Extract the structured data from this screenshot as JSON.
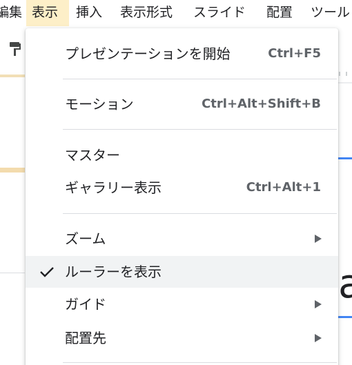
{
  "menubar": {
    "items": [
      {
        "label": "編集",
        "active": false
      },
      {
        "label": "表示",
        "active": true
      },
      {
        "label": "挿入",
        "active": false
      },
      {
        "label": "表示形式",
        "active": false
      },
      {
        "label": "スライド",
        "active": false
      },
      {
        "label": "配置",
        "active": false
      },
      {
        "label": "ツール",
        "active": false
      }
    ]
  },
  "background": {
    "slide_text": "a",
    "paint_format_icon": "paint-format-icon"
  },
  "view_menu": {
    "items": [
      {
        "label": "プレゼンテーションを開始",
        "shortcut": "Ctrl+F5"
      },
      {
        "label": "モーション",
        "shortcut": "Ctrl+Alt+Shift+B"
      },
      {
        "label": "マスター",
        "shortcut": ""
      },
      {
        "label": "ギャラリー表示",
        "shortcut": "Ctrl+Alt+1"
      },
      {
        "label": "ズーム",
        "submenu": true
      },
      {
        "label": "ルーラーを表示",
        "checked": true
      },
      {
        "label": "ガイド",
        "submenu": true
      },
      {
        "label": "配置先",
        "submenu": true
      }
    ]
  },
  "colors": {
    "active_menu_bg": "#fdefc8",
    "hover_item_bg": "#f1f3f4",
    "text": "#202124",
    "shortcut_text": "#5f6368"
  }
}
